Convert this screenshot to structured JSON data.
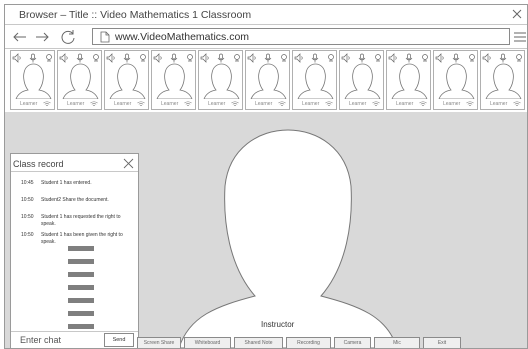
{
  "browser": {
    "title": "Browser – Title :: Video Mathematics 1 Classroom",
    "url": "www.VideoMathematics.com"
  },
  "learners": [
    {
      "label": "Learner"
    },
    {
      "label": "Learner"
    },
    {
      "label": "Learner"
    },
    {
      "label": "Learner"
    },
    {
      "label": "Learner"
    },
    {
      "label": "Learner"
    },
    {
      "label": "Learner"
    },
    {
      "label": "Learner"
    },
    {
      "label": "Learner"
    },
    {
      "label": "Learner"
    },
    {
      "label": "Learner"
    }
  ],
  "instructor": {
    "label": "Instructor"
  },
  "class_record": {
    "title": "Class record",
    "entries": [
      {
        "time": "10:45",
        "message": "Student 1 has entered."
      },
      {
        "time": "10:50",
        "message": "Student2 Share the document."
      },
      {
        "time": "10:50",
        "message": "Student 1 has requested the right to speak."
      },
      {
        "time": "10:50",
        "message": "Student 1 has been given the right to speak."
      }
    ],
    "chat_placeholder": "Enter chat",
    "send_label": "Send"
  },
  "controls": [
    {
      "label": "Screen Share"
    },
    {
      "label": "Whiteboard"
    },
    {
      "label": "Shared Note"
    },
    {
      "label": "Recording"
    },
    {
      "label": "Camera"
    },
    {
      "label": "Mic"
    },
    {
      "label": "Exit"
    }
  ]
}
